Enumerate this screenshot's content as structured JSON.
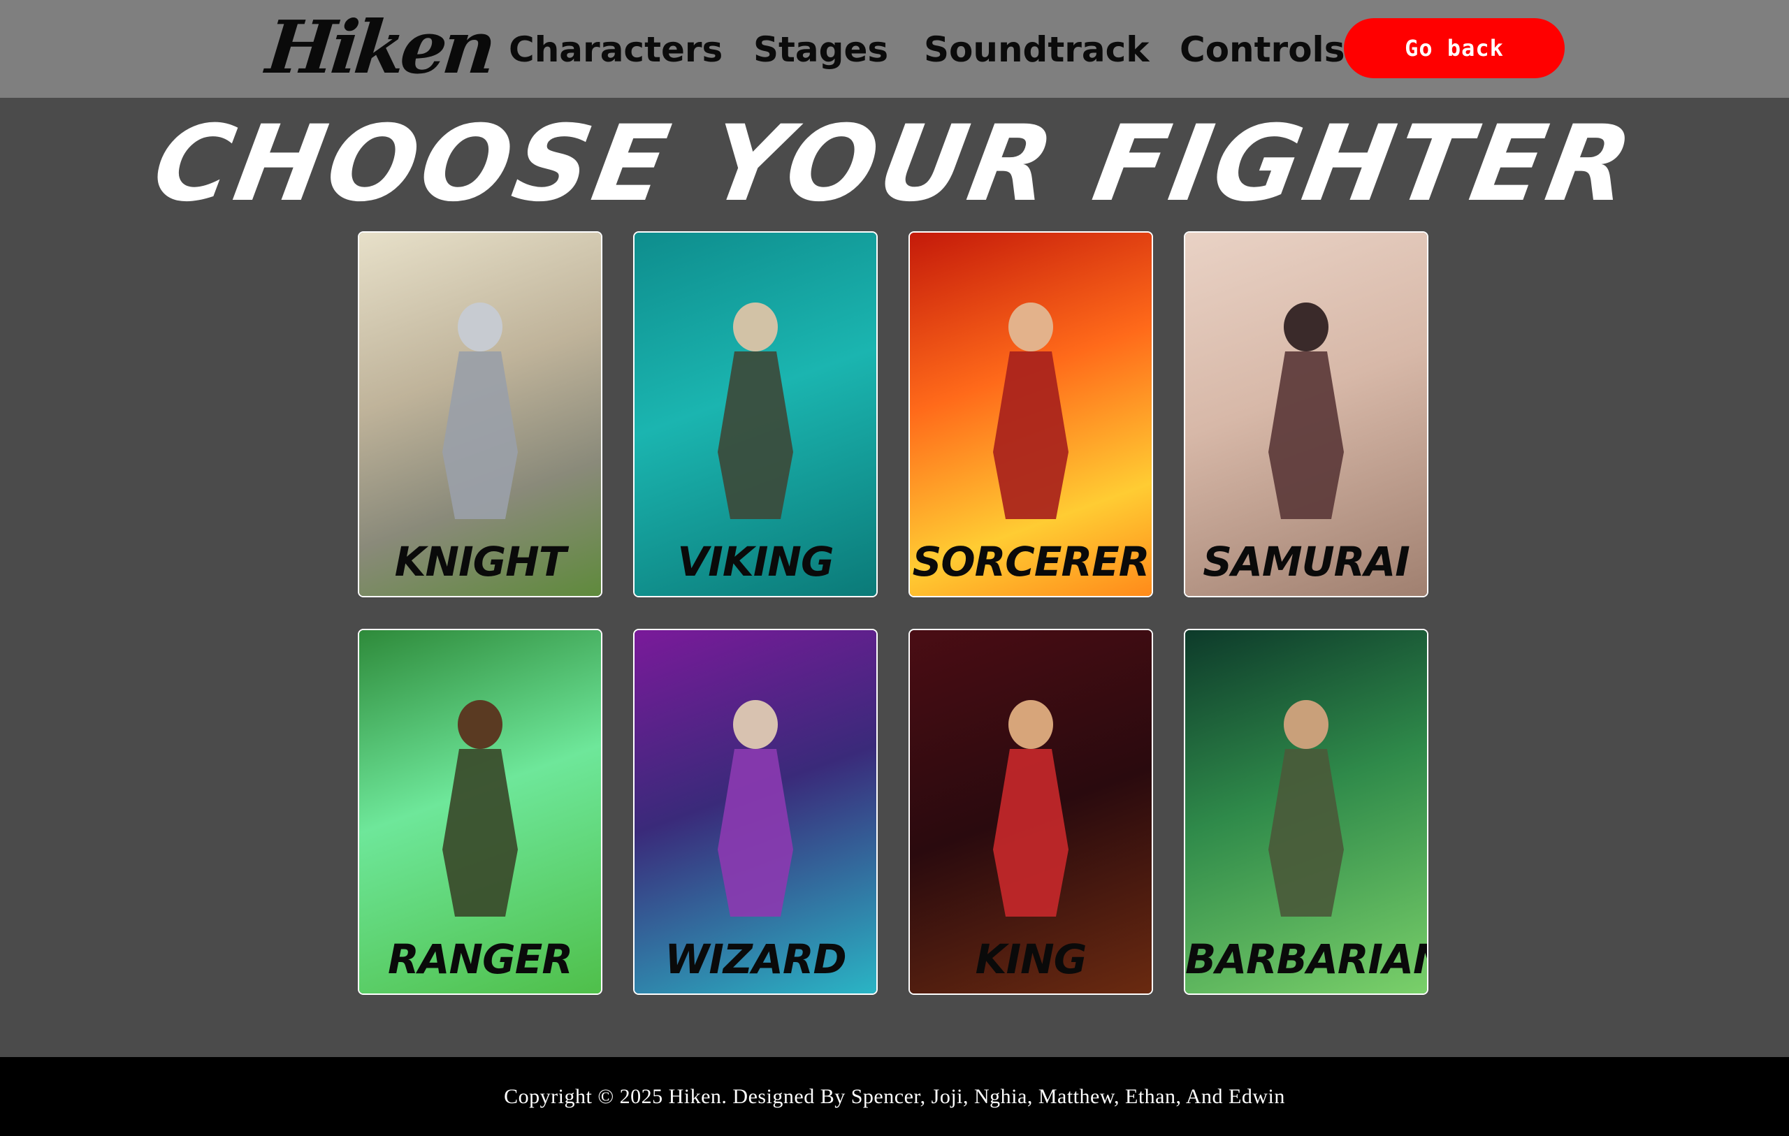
{
  "nav": {
    "logo": "Hiken",
    "links": [
      "Characters",
      "Stages",
      "Soundtrack",
      "Controls"
    ],
    "go_back_label": "Go back",
    "go_back_color": "#ff0000"
  },
  "main": {
    "title": "Choose Your Fighter",
    "characters": [
      {
        "name": "Knight",
        "bg": "linear-gradient(160deg, #e7e0c9 0%, #bfb39a 40%, #8a8a7a 70%, #5f8a3c 100%)",
        "cape": "#9aa0a8",
        "head": "#c7cbd1"
      },
      {
        "name": "Viking",
        "bg": "linear-gradient(160deg, #0e8d8d 0%, #1bb5b0 45%, #0b7a78 100%)",
        "cape": "#3c4a3a",
        "head": "#d2c2a6"
      },
      {
        "name": "Sorcerer",
        "bg": "linear-gradient(160deg, #c41a0a 0%, #ff6a1a 40%, #ffcc33 75%, #ff8a1a 100%)",
        "cape": "#a8221c",
        "head": "#e3b28b"
      },
      {
        "name": "Samurai",
        "bg": "linear-gradient(160deg, #e9d2c5 0%, #d7b8a8 45%, #a08070 100%)",
        "cape": "#5c3a3a",
        "head": "#3a2a2a"
      },
      {
        "name": "Ranger",
        "bg": "linear-gradient(160deg, #2e8a3a 0%, #6ee79a 45%, #4fbf4a 100%)",
        "cape": "#3a4a2a",
        "head": "#5a3a22"
      },
      {
        "name": "Wizard",
        "bg": "linear-gradient(160deg, #7a1a9a 0%, #3a2a7a 45%, #2ab5c5 100%)",
        "cape": "#8a3ab0",
        "head": "#d8c2b0"
      },
      {
        "name": "King",
        "bg": "linear-gradient(160deg, #4a0d14 0%, #2a0a0e 50%, #6a2a10 100%)",
        "cape": "#c4282a",
        "head": "#d7a57a"
      },
      {
        "name": "Barbarian",
        "bg": "linear-gradient(160deg, #0d3a2a 0%, #2f8a4a 45%, #7ad06a 100%)",
        "cape": "#4a5a3a",
        "head": "#c9a07a"
      }
    ]
  },
  "footer": {
    "text": "Copyright © 2025 Hiken. Designed By Spencer, Joji, Nghia, Matthew, Ethan, And Edwin"
  }
}
